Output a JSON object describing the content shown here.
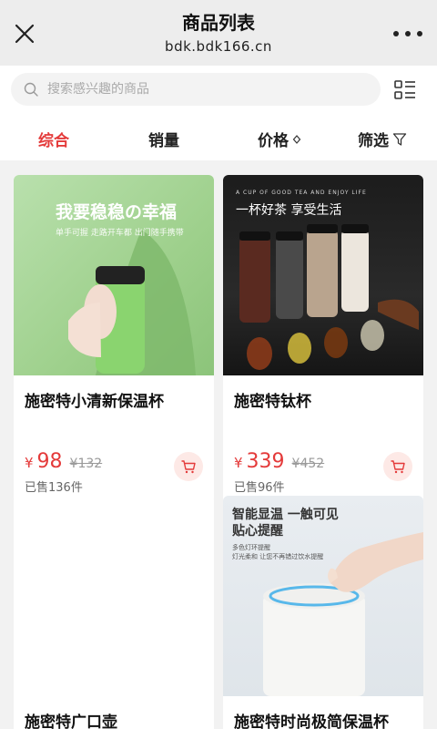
{
  "header": {
    "title": "商品列表",
    "subtitle": "bdk.bdk166.cn"
  },
  "search": {
    "placeholder": "搜索感兴趣的商品"
  },
  "sort_tabs": [
    "综合",
    "销量",
    "价格",
    "筛选"
  ],
  "icons": {
    "close": "close-icon",
    "more": "more-icon",
    "search": "search-icon",
    "layout": "list-layout-icon",
    "sort": "sort-diamond-icon",
    "filter": "funnel-icon",
    "cart": "cart-icon"
  },
  "colors": {
    "accent": "#e43a3a",
    "cart_bg": "#fde9e6"
  },
  "products": [
    {
      "name": "施密特小清新保温杯",
      "currency": "¥",
      "price": "98",
      "original_price": "¥132",
      "sold": "已售136件",
      "image_text_main": "我要稳稳の幸福",
      "image_text_sub": "单手可握 走路开车都 出门随手携带"
    },
    {
      "name": "施密特钛杯",
      "currency": "¥",
      "price": "339",
      "original_price": "¥452",
      "sold": "已售96件",
      "image_text_tagline": "A CUP OF GOOD TEA AND ENJOY LIFE",
      "image_text_main": "一杯好茶 享受生活"
    },
    {
      "name": "施密特广口壶"
    },
    {
      "name": "施密特时尚极简保温杯",
      "image_text_main1": "智能显温 一触可见",
      "image_text_main2": "贴心提醒",
      "image_text_sub1": "多色灯环提醒",
      "image_text_sub2": "灯光柔和 让您不再错过饮水提醒"
    }
  ]
}
